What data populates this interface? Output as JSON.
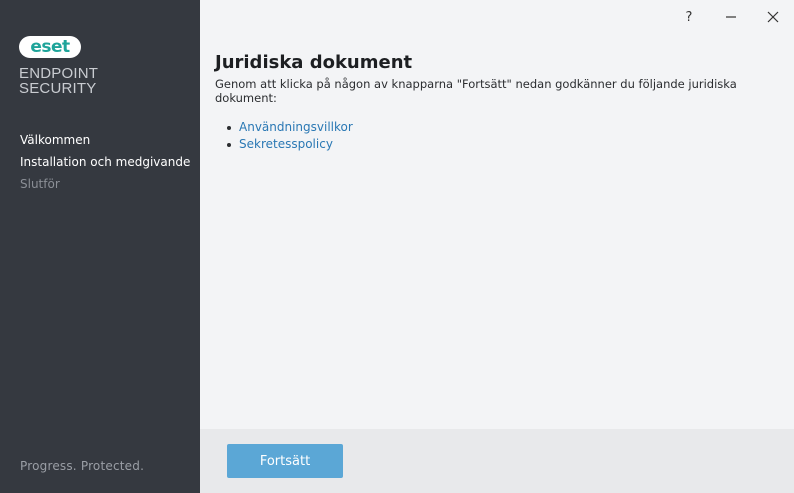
{
  "brand": {
    "logo_text": "eset",
    "product_line1": "ENDPOINT",
    "product_line2": "SECURITY",
    "tagline": "Progress. Protected."
  },
  "steps": [
    {
      "label": "Välkommen",
      "state": "done"
    },
    {
      "label": "Installation och medgivande",
      "state": "current"
    },
    {
      "label": "Slutför",
      "state": "pending"
    }
  ],
  "titlebar": {
    "help": "?",
    "minimize": "—",
    "close": "✕"
  },
  "main": {
    "title": "Juridiska dokument",
    "intro": "Genom att klicka på någon av knapparna \"Fortsätt\" nedan godkänner du följande juridiska dokument:",
    "links": [
      {
        "label": "Användningsvillkor"
      },
      {
        "label": "Sekretesspolicy"
      }
    ]
  },
  "footer": {
    "continue_label": "Fortsätt"
  },
  "colors": {
    "sidebar_bg": "#353940",
    "accent": "#5ba7d6",
    "link": "#2a78b4",
    "brand_teal": "#1ea49a"
  }
}
